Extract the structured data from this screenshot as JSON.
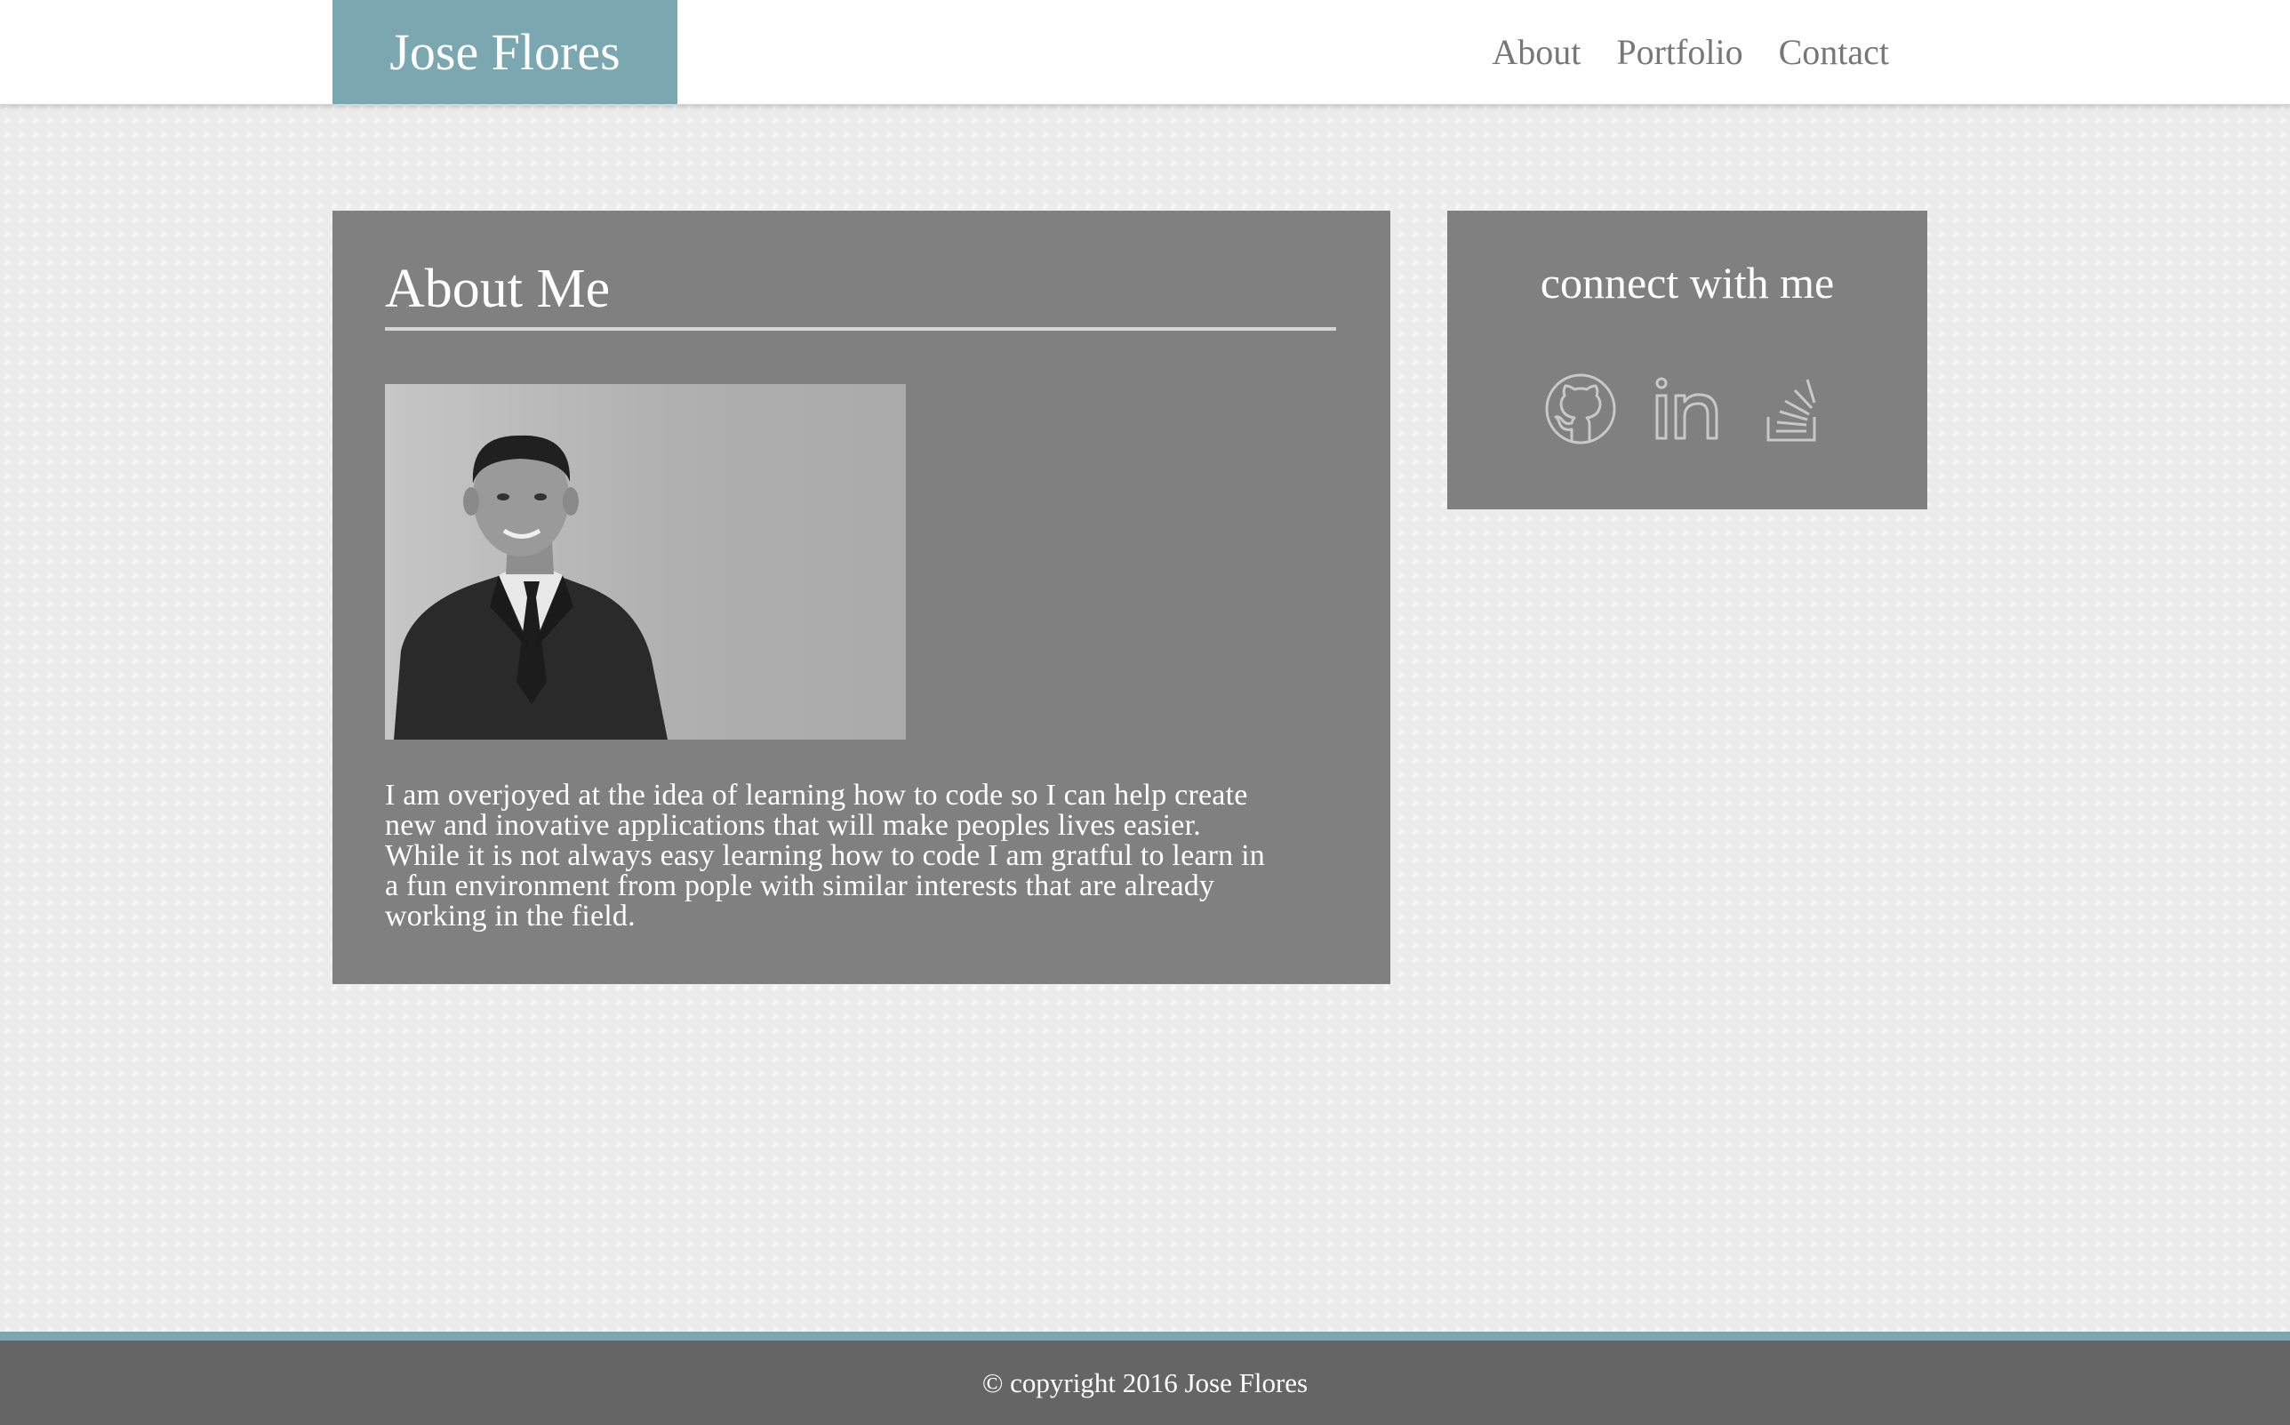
{
  "header": {
    "brand": "Jose Flores",
    "nav": [
      {
        "label": "About"
      },
      {
        "label": "Portfolio"
      },
      {
        "label": "Contact"
      }
    ]
  },
  "about": {
    "title": "About Me",
    "text": "I am overjoyed at the idea of learning how to code so I can help create new and inovative applications that will make peoples lives easier. While it is not always easy learning how to code I am gratful to learn in a fun environment from pople with similar interests that are already working in the field."
  },
  "connect": {
    "title": "connect with me",
    "icons": [
      "github-icon",
      "linkedin-icon",
      "stack-overflow-icon"
    ]
  },
  "footer": {
    "copyright": "© copyright 2016 Jose Flores"
  },
  "colors": {
    "accent": "#7ba8b0",
    "panel": "#808080",
    "footer": "#656565",
    "nav_text": "#777777"
  }
}
